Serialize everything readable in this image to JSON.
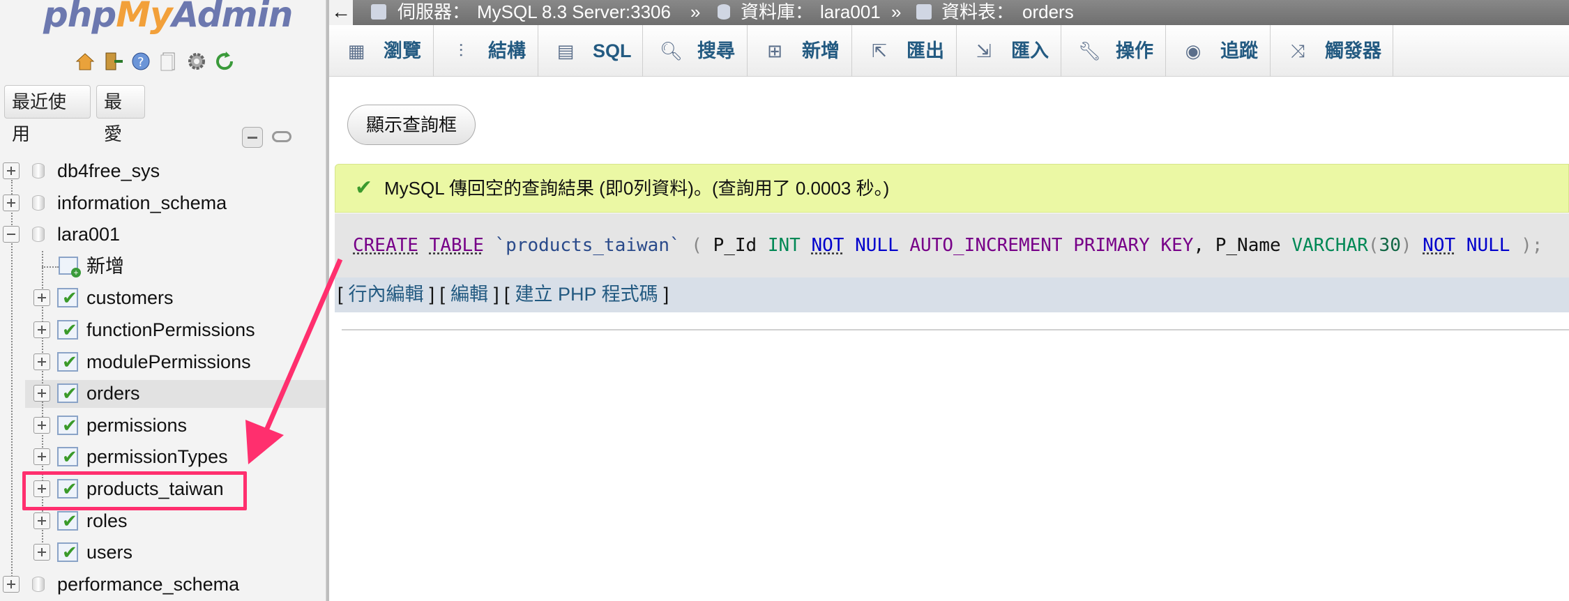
{
  "logo": {
    "php": "php",
    "my": "My",
    "admin": "Admin"
  },
  "nav": {
    "recent_tab": "最近使用",
    "favorites_tab": "最愛",
    "tree": [
      {
        "label": "db4free_sys",
        "type": "db",
        "expanded": false
      },
      {
        "label": "information_schema",
        "type": "db",
        "expanded": false
      },
      {
        "label": "lara001",
        "type": "db",
        "expanded": true
      },
      {
        "label": "新增",
        "type": "new"
      },
      {
        "label": "customers",
        "type": "table"
      },
      {
        "label": "functionPermissions",
        "type": "table"
      },
      {
        "label": "modulePermissions",
        "type": "table"
      },
      {
        "label": "orders",
        "type": "table",
        "selected": true
      },
      {
        "label": "permissions",
        "type": "table"
      },
      {
        "label": "permissionTypes",
        "type": "table"
      },
      {
        "label": "products_taiwan",
        "type": "table",
        "highlighted": true
      },
      {
        "label": "roles",
        "type": "table"
      },
      {
        "label": "users",
        "type": "table"
      },
      {
        "label": "performance_schema",
        "type": "db",
        "expanded": false
      }
    ]
  },
  "breadcrumb": {
    "back": "←",
    "server_label": "伺服器：",
    "server_value": "MySQL 8.3 Server:3306",
    "sep1": "»",
    "db_label": "資料庫：",
    "db_value": "lara001",
    "sep2": "»",
    "table_label": "資料表：",
    "table_value": "orders"
  },
  "tabs": [
    {
      "label": "瀏覽",
      "icon": "browse-icon"
    },
    {
      "label": "結構",
      "icon": "structure-icon"
    },
    {
      "label": "SQL",
      "icon": "sql-icon"
    },
    {
      "label": "搜尋",
      "icon": "search-icon"
    },
    {
      "label": "新增",
      "icon": "insert-icon"
    },
    {
      "label": "匯出",
      "icon": "export-icon"
    },
    {
      "label": "匯入",
      "icon": "import-icon"
    },
    {
      "label": "操作",
      "icon": "wrench-icon"
    },
    {
      "label": "追蹤",
      "icon": "eye-icon"
    },
    {
      "label": "觸發器",
      "icon": "trigger-icon"
    }
  ],
  "main": {
    "show_query_button": "顯示查詢框",
    "success_message": "MySQL 傳回空的查詢結果 (即0列資料)。(查詢用了 0.0003 秒。)",
    "sql": {
      "create": "CREATE",
      "table": "TABLE",
      "name": "`products_taiwan`",
      "paren_open": "(",
      "col1": "P_Id",
      "int": "INT",
      "not1": "NOT",
      "null1": "NULL",
      "auto": "AUTO_INCREMENT",
      "primary": "PRIMARY",
      "key": "KEY",
      "comma": ",",
      "col2": "P_Name",
      "varchar": "VARCHAR",
      "lp": "(",
      "len": "30",
      "rp": ")",
      "not2": "NOT",
      "null2": "NULL",
      "paren_close": ");"
    },
    "links": {
      "inline_edit": "行內編輯",
      "edit": "編輯",
      "create_php": "建立 PHP 程式碼"
    }
  },
  "colors": {
    "annotation": "#ff2f6e",
    "success_bg": "#ebf8a4",
    "tab_text": "#235a81"
  }
}
